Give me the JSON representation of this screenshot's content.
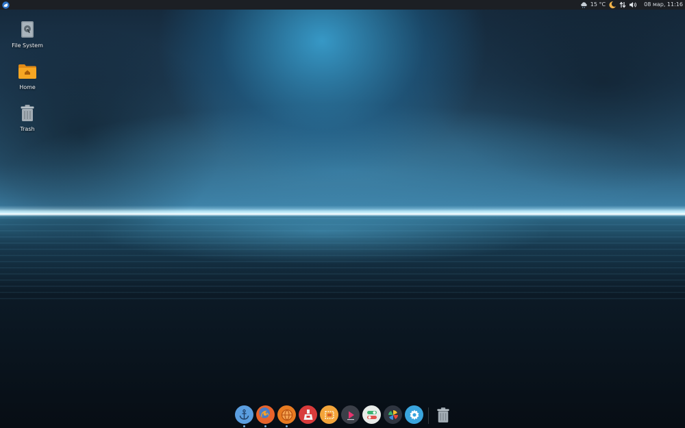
{
  "top_panel": {
    "menu_icon": "xfce-menu-icon",
    "weather_icon": "cloud-rain-icon",
    "temperature": "15 °C",
    "night_icon": "moon-icon",
    "network_icon": "network-updown-icon",
    "volume_icon": "speaker-icon",
    "clock": "08 мар, 11:16"
  },
  "desktop_icons": [
    {
      "label": "File System",
      "icon": "file-system-icon"
    },
    {
      "label": "Home",
      "icon": "home-folder-icon"
    },
    {
      "label": "Trash",
      "icon": "trash-icon"
    }
  ],
  "dock": {
    "items": [
      {
        "name": "anchor",
        "icon": "anchor-icon",
        "color": "#5b9ee0",
        "running": true
      },
      {
        "name": "firefox",
        "icon": "firefox-icon",
        "color": "#e8632b",
        "running": true
      },
      {
        "name": "browser",
        "icon": "orange-globe-icon",
        "color": "#e77b22",
        "running": true
      },
      {
        "name": "software-installer",
        "icon": "package-icon",
        "color": "#d83b3b",
        "running": false
      },
      {
        "name": "screenshot",
        "icon": "screenshot-icon",
        "color": "#f3a53b",
        "running": false
      },
      {
        "name": "media-player",
        "icon": "play-icon",
        "color": "#3b3f48",
        "running": false
      },
      {
        "name": "settings-toggle",
        "icon": "toggle-icon",
        "color": "#e8ece9",
        "running": false
      },
      {
        "name": "image-viewer",
        "icon": "pinwheel-icon",
        "color": "#2f3540",
        "running": false
      },
      {
        "name": "system-settings",
        "icon": "gear-icon",
        "color": "#3aa5de",
        "running": false
      }
    ],
    "trash_icon": "trash-icon"
  }
}
